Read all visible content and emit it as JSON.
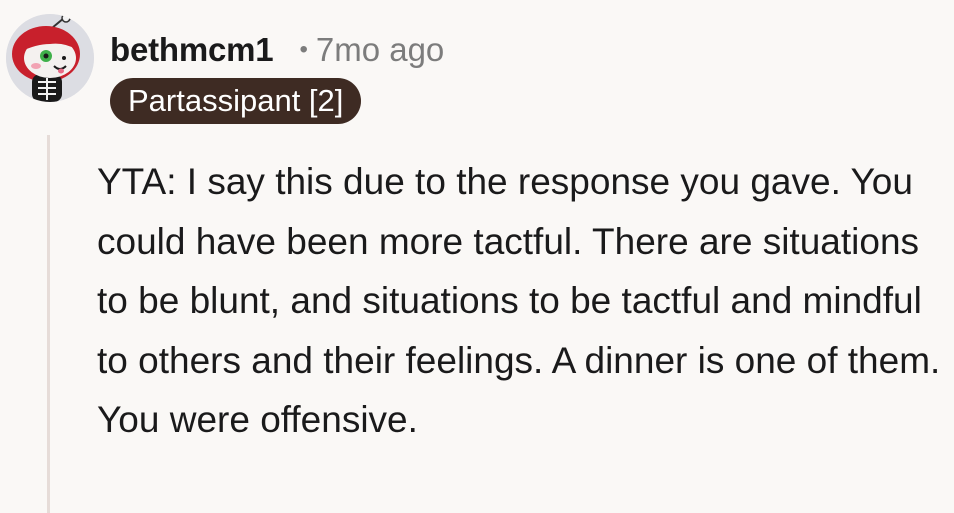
{
  "comment": {
    "author": "bethmcm1",
    "separator": "•",
    "timestamp": "7mo ago",
    "flair": "Partassipant [2]",
    "body": "YTA: I say this due to the response you gave. You could have been more tactful. There are situations to be blunt, and situations to be tactful and mindful to others and their feelings. A dinner is one of them. You were offensive."
  },
  "icons": {
    "avatar": "snoo-avatar-icon"
  },
  "colors": {
    "background": "#faf8f6",
    "flair_background": "#3e2b23",
    "flair_text": "#ffffff",
    "meta_text": "#7c7c7c",
    "thread_line": "#e6dcd8"
  }
}
